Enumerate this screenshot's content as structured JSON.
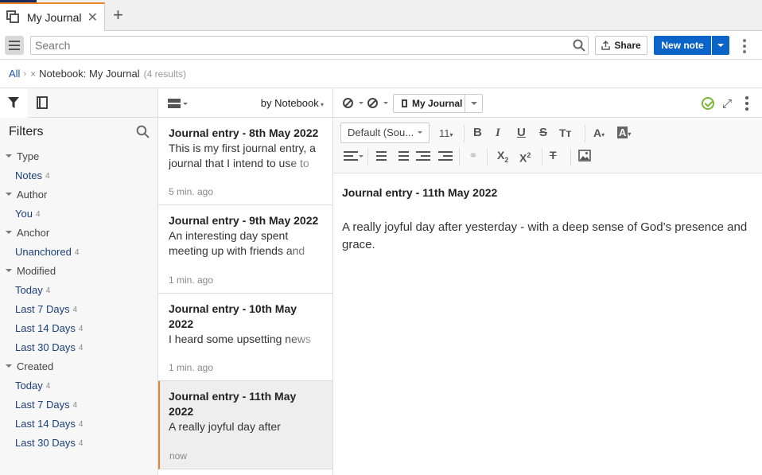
{
  "tabs": [
    {
      "title": "My Journal"
    }
  ],
  "toolbar": {
    "search_placeholder": "Search",
    "share_label": "Share",
    "new_note_label": "New note"
  },
  "breadcrumb": {
    "root": "All",
    "separator": "›",
    "notebook": "Notebook: My Journal",
    "results": "(4 results)"
  },
  "filters": {
    "title": "Filters",
    "sections": [
      {
        "label": "Type",
        "items": [
          {
            "label": "Notes",
            "count": "4"
          }
        ]
      },
      {
        "label": "Author",
        "items": [
          {
            "label": "You",
            "count": "4"
          }
        ]
      },
      {
        "label": "Anchor",
        "items": [
          {
            "label": "Unanchored",
            "count": "4"
          }
        ]
      },
      {
        "label": "Modified",
        "items": [
          {
            "label": "Today",
            "count": "4"
          },
          {
            "label": "Last 7 Days",
            "count": "4"
          },
          {
            "label": "Last 14 Days",
            "count": "4"
          },
          {
            "label": "Last 30 Days",
            "count": "4"
          }
        ]
      },
      {
        "label": "Created",
        "items": [
          {
            "label": "Today",
            "count": "4"
          },
          {
            "label": "Last 7 Days",
            "count": "4"
          },
          {
            "label": "Last 14 Days",
            "count": "4"
          },
          {
            "label": "Last 30 Days",
            "count": "4"
          }
        ]
      }
    ]
  },
  "notes_list": {
    "sort_label": "by Notebook",
    "notes": [
      {
        "title": "Journal entry - 8th May 2022",
        "snippet": "This is my first journal entry, a journal that I intend to use to",
        "time": "5 min. ago"
      },
      {
        "title": "Journal entry - 9th May 2022",
        "snippet": "An interesting day spent meeting up with friends and",
        "time": "1 min. ago"
      },
      {
        "title": "Journal entry - 10th May 2022",
        "snippet": "I heard some upsetting news",
        "time": "1 min. ago"
      },
      {
        "title": "Journal entry - 11th May 2022",
        "snippet": "A really joyful day after",
        "time": "now"
      }
    ]
  },
  "editor": {
    "notebook": "My Journal",
    "font": "Default (Sou...",
    "font_size": "11",
    "note_title": "Journal entry - 11th May 2022",
    "note_body": "A really joyful day after yesterday - with a deep sense of God’s presence and grace."
  },
  "colors": {
    "accent_tab": "#e8832a",
    "primary_button": "#0b65c8",
    "link": "#1a3f7a",
    "saved_check": "#79b83a"
  }
}
